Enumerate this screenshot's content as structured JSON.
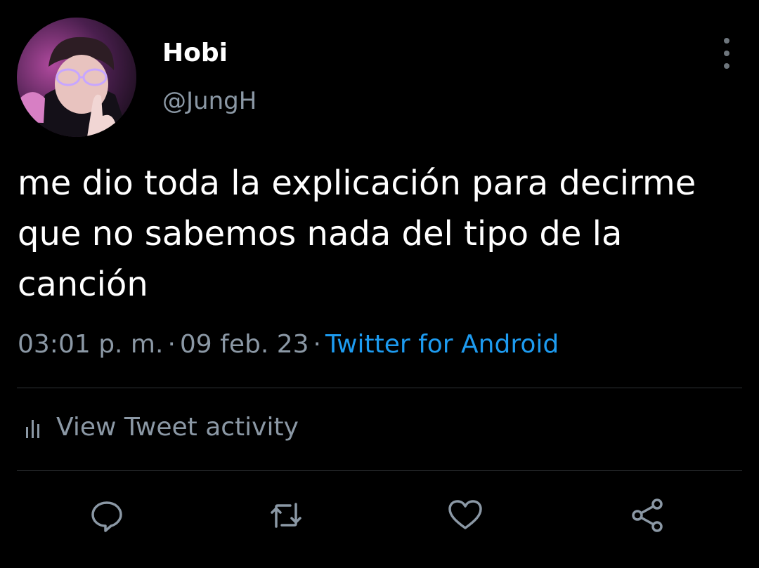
{
  "author": {
    "display_name": "Hobi",
    "handle": "@JungH",
    "avatar_icon": "profile-photo"
  },
  "tweet": {
    "text": "me dio toda la explicación para decirme\nque no sabemos nada del tipo de la\ncanción",
    "time": "03:01 p. m.",
    "separator": "·",
    "date": "09 feb. 23",
    "source": "Twitter for Android"
  },
  "activity": {
    "label": "View Tweet activity",
    "icon": "bar-chart-icon"
  },
  "actions": {
    "reply_icon": "reply-icon",
    "retweet_icon": "retweet-icon",
    "like_icon": "heart-icon",
    "share_icon": "share-icon"
  },
  "colors": {
    "background": "#000000",
    "text_primary": "#ffffff",
    "text_secondary": "#8b98a5",
    "link": "#1d9bf0",
    "divider": "#2f3336",
    "icon": "#8b98a5"
  }
}
